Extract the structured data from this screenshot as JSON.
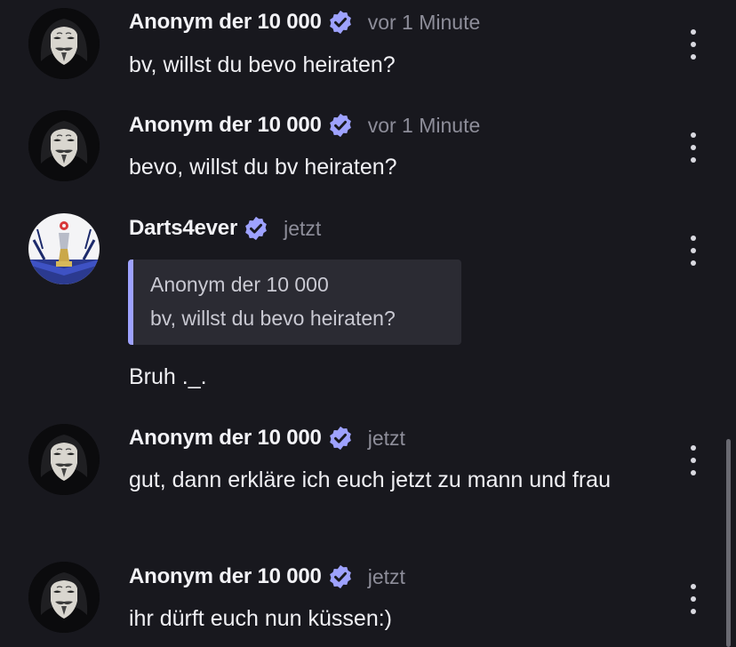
{
  "colors": {
    "background": "#18181e",
    "verified_badge": "#9ea2ff",
    "quote_accent": "#9ea2ff",
    "timestamp": "#8d8d99"
  },
  "messages": [
    {
      "author": "Anonym der 10 000",
      "verified": true,
      "time": "vor 1 Minute",
      "avatar_icon": "anonymous-mask-avatar",
      "text": "bv, willst du bevo heiraten?"
    },
    {
      "author": "Anonym der 10 000",
      "verified": true,
      "time": "vor 1 Minute",
      "avatar_icon": "anonymous-mask-avatar",
      "text": "bevo, willst du bv heiraten?"
    },
    {
      "author": "Darts4ever",
      "verified": true,
      "time": "jetzt",
      "avatar_icon": "darts-trophy-avatar",
      "quote": {
        "author": "Anonym der 10 000",
        "text": "bv, willst du bevo heiraten?"
      },
      "text": "Bruh ._."
    },
    {
      "author": "Anonym der 10 000",
      "verified": true,
      "time": "jetzt",
      "avatar_icon": "anonymous-mask-avatar",
      "text": "gut, dann erkläre ich euch jetzt zu mann und frau"
    },
    {
      "author": "Anonym der 10 000",
      "verified": true,
      "time": "jetzt",
      "avatar_icon": "anonymous-mask-avatar",
      "text": "ihr dürft euch nun küssen:)"
    }
  ]
}
